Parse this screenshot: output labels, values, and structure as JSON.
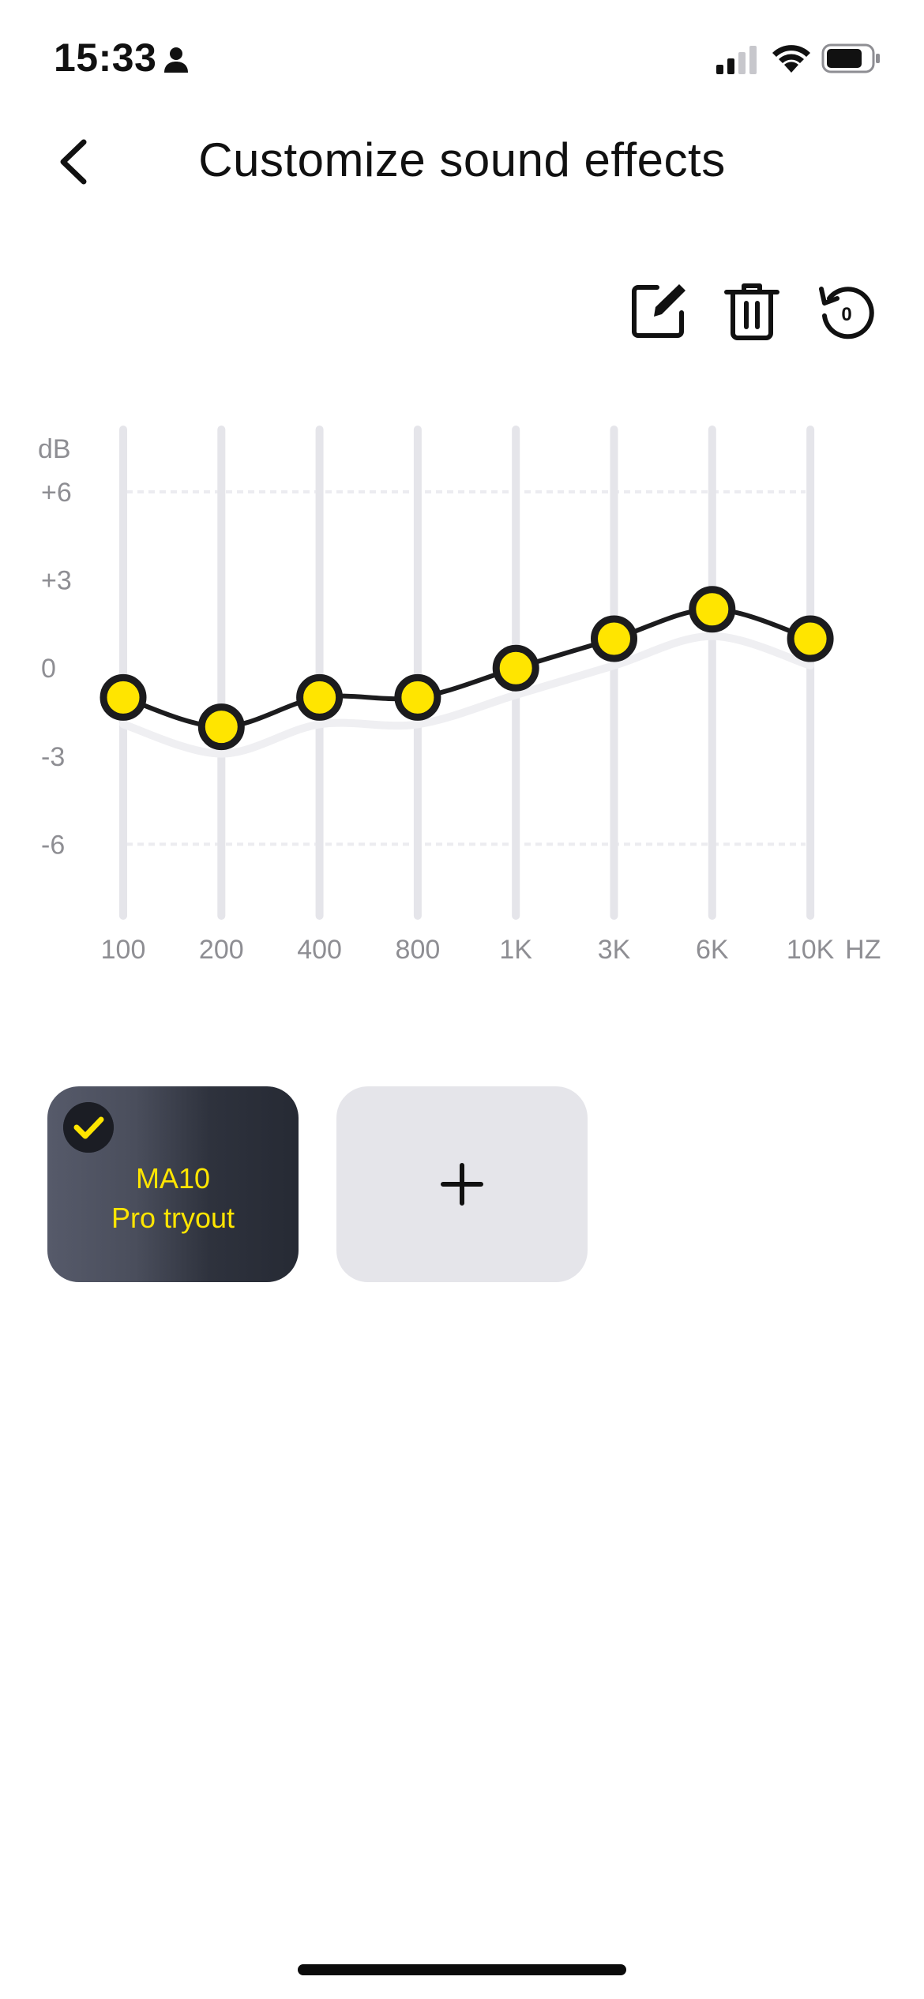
{
  "status_bar": {
    "time": "15:33",
    "icons": [
      "person-icon",
      "cellular-signal-icon",
      "wifi-icon",
      "battery-icon"
    ]
  },
  "header": {
    "title": "Customize sound effects",
    "back_icon": "chevron-left-icon"
  },
  "toolbar": {
    "icons": [
      "edit-icon",
      "trash-icon",
      "reset-icon"
    ],
    "reset_badge": "0"
  },
  "chart_data": {
    "type": "line",
    "unit_label": "dB",
    "axis_unit": "HZ",
    "y_ticks": [
      "+6",
      "+3",
      "0",
      "-3",
      "-6"
    ],
    "ylim": [
      -9,
      7
    ],
    "categories": [
      "100",
      "200",
      "400",
      "800",
      "1K",
      "3K",
      "6K",
      "10K"
    ],
    "series": [
      {
        "values": [
          -1,
          -2,
          -1,
          -1,
          0,
          1,
          2,
          1
        ]
      }
    ],
    "point_color": "#FFE500",
    "line_color": "#1C1C1E",
    "track_color": "#E5E5EA"
  },
  "presets": {
    "items": [
      {
        "label_line1": "MA10",
        "label_line2": "Pro tryout",
        "selected": true
      }
    ],
    "add_icon": "plus-icon"
  },
  "colors": {
    "accent": "#FFE500",
    "card_dark": "#2E323D",
    "card_light": "#E5E5EA"
  }
}
